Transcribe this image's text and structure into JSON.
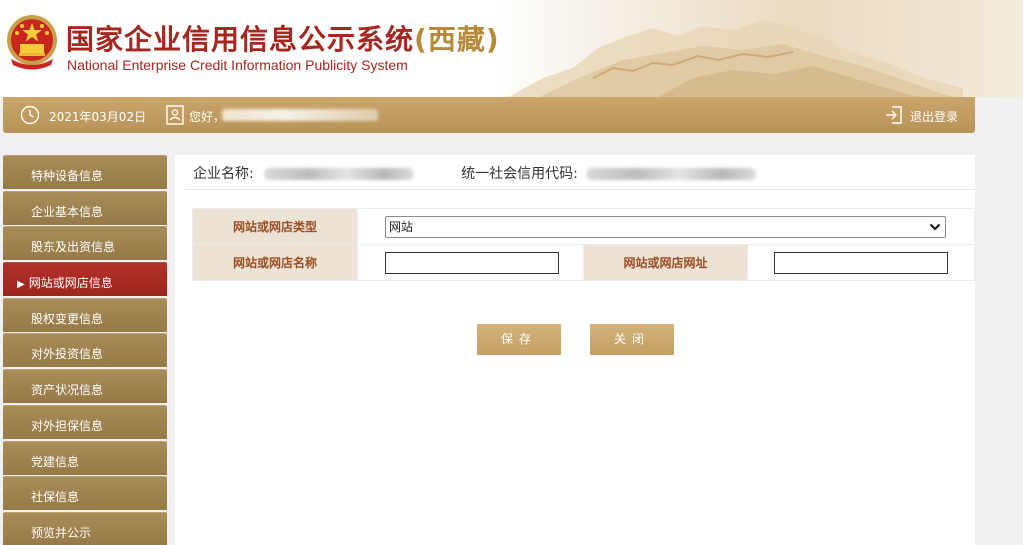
{
  "header": {
    "title": "国家企业信用信息公示系统",
    "region": "(西藏)",
    "subtitle": "National Enterprise Credit Information Publicity System"
  },
  "topbar": {
    "date": "2021年03月02日",
    "greeting": "您好，",
    "logout_label": "退出登录"
  },
  "sidebar": {
    "items": [
      {
        "label": "特种设备信息",
        "active": false
      },
      {
        "label": "企业基本信息",
        "active": false
      },
      {
        "label": "股东及出资信息",
        "active": false
      },
      {
        "label": "网站或网店信息",
        "active": true
      },
      {
        "label": "股权变更信息",
        "active": false
      },
      {
        "label": "对外投资信息",
        "active": false
      },
      {
        "label": "资产状况信息",
        "active": false
      },
      {
        "label": "对外担保信息",
        "active": false
      },
      {
        "label": "党建信息",
        "active": false
      },
      {
        "label": "社保信息",
        "active": false
      },
      {
        "label": "预览并公示",
        "active": false
      }
    ],
    "active_marker": "▶"
  },
  "info": {
    "company_name_label": "企业名称:",
    "credit_code_label": "统一社会信用代码:"
  },
  "form": {
    "type_label": "网站或网店类型",
    "type_value": "网站",
    "name_label": "网站或网店名称",
    "name_value": "",
    "url_label": "网站或网店网址",
    "url_value": ""
  },
  "buttons": {
    "save_label": "保存",
    "close_label": "关闭"
  },
  "colors": {
    "brand_red": "#a5271f",
    "gold": "#b58b3a",
    "sidebar": "#a08550",
    "sidebar_active": "#a8291f",
    "label_bg": "#ece3d6"
  }
}
